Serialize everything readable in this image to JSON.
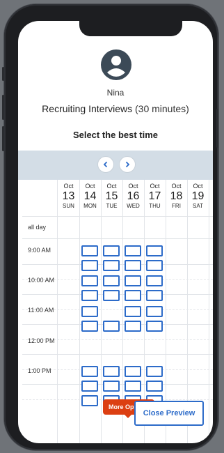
{
  "host": {
    "name": "Nina"
  },
  "event": {
    "title": "Recruiting Interviews",
    "duration": "(30 minutes)"
  },
  "prompt": "Select the best time",
  "nav": {
    "prev_icon": "chevron-left-icon",
    "next_icon": "chevron-right-icon"
  },
  "days": [
    {
      "month": "Oct",
      "date": "13",
      "weekday": "SUN"
    },
    {
      "month": "Oct",
      "date": "14",
      "weekday": "MON"
    },
    {
      "month": "Oct",
      "date": "15",
      "weekday": "TUE"
    },
    {
      "month": "Oct",
      "date": "16",
      "weekday": "WED"
    },
    {
      "month": "Oct",
      "date": "17",
      "weekday": "THU"
    },
    {
      "month": "Oct",
      "date": "18",
      "weekday": "FRI"
    },
    {
      "month": "Oct",
      "date": "19",
      "weekday": "SAT"
    }
  ],
  "time_labels": [
    "all day",
    "9:00 AM",
    "10:00 AM",
    "11:00 AM",
    "12:00 PM",
    "1:00 PM"
  ],
  "availability": {
    "MON": [
      "9:00",
      "9:30",
      "10:00",
      "10:30",
      "11:00",
      "11:30",
      "1:00",
      "1:30",
      "2:00"
    ],
    "TUE": [
      "9:00",
      "9:30",
      "10:00",
      "10:30",
      "11:30",
      "1:00",
      "1:30",
      "2:00"
    ],
    "WED": [
      "9:00",
      "9:30",
      "10:00",
      "10:30",
      "11:00",
      "11:30",
      "1:00",
      "1:30",
      "2:00"
    ],
    "THU": [
      "9:00",
      "9:30",
      "10:00",
      "10:30",
      "11:00",
      "11:30",
      "1:00",
      "1:30",
      "2:00"
    ]
  },
  "buttons": {
    "more_options": "More Options",
    "close_preview": "Close Preview"
  },
  "colors": {
    "slot_border": "#2c6bc9",
    "accent_orange": "#dc3f12",
    "nav_bar": "#d3dde6"
  }
}
